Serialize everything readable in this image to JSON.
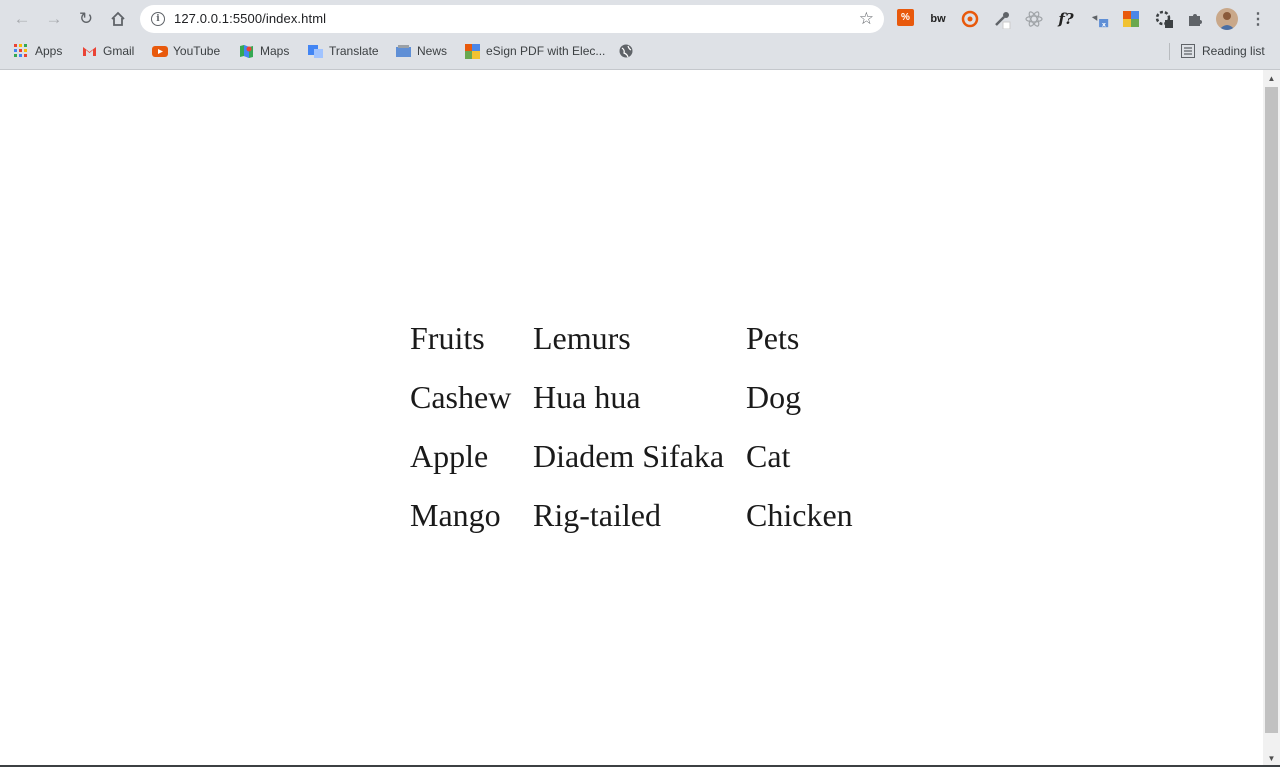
{
  "browser": {
    "url": "127.0.0.1:5500/index.html",
    "bookmarks": [
      {
        "label": "Apps",
        "icon": "apps-grid-icon"
      },
      {
        "label": "Gmail",
        "icon": "gmail-icon"
      },
      {
        "label": "YouTube",
        "icon": "youtube-icon"
      },
      {
        "label": "Maps",
        "icon": "maps-icon"
      },
      {
        "label": "Translate",
        "icon": "translate-icon"
      },
      {
        "label": "News",
        "icon": "news-icon"
      },
      {
        "label": "eSign PDF with Elec...",
        "icon": "esign-icon"
      },
      {
        "label": "",
        "icon": "globe-icon"
      }
    ],
    "reading_list_label": "Reading list",
    "extensions": [
      "transifex-icon",
      "bw-icon",
      "eye-icon",
      "dropper-icon",
      "react-icon",
      "font-icon",
      "translate-ext-icon",
      "grid-ext-icon",
      "gear-ext-icon",
      "puzzle-icon"
    ],
    "accent_colors": {
      "chrome_bg": "#dee1e6",
      "text": "#1a1a1a"
    }
  },
  "columns": [
    {
      "items": [
        "Fruits",
        "Cashew",
        "Apple",
        "Mango"
      ]
    },
    {
      "items": [
        "Lemurs",
        "Hua hua",
        "Diadem Sifaka",
        "Rig-tailed"
      ]
    },
    {
      "items": [
        "Pets",
        "Dog",
        "Cat",
        "Chicken"
      ]
    }
  ],
  "ext_labels": {
    "bw": "bw",
    "font": "f?"
  }
}
